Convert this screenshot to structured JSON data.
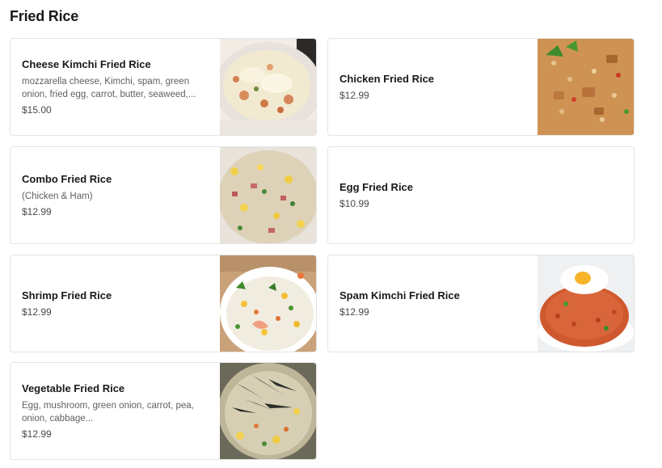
{
  "section": {
    "title": "Fried Rice"
  },
  "items": [
    {
      "name": "Cheese Kimchi Fried Rice",
      "description": "mozzarella cheese, Kimchi, spam, green onion, fried egg, carrot, butter, seaweed,...",
      "price": "$15.00",
      "image": "cheese-kimchi-fried-rice-photo"
    },
    {
      "name": "Chicken Fried Rice",
      "description": "",
      "price": "$12.99",
      "image": "chicken-fried-rice-photo"
    },
    {
      "name": "Combo Fried Rice",
      "description": "(Chicken & Ham)",
      "price": "$12.99",
      "image": "combo-fried-rice-photo"
    },
    {
      "name": "Egg Fried Rice",
      "description": "",
      "price": "$10.99",
      "image": ""
    },
    {
      "name": "Shrimp Fried Rice",
      "description": "",
      "price": "$12.99",
      "image": "shrimp-fried-rice-photo"
    },
    {
      "name": "Spam Kimchi Fried Rice",
      "description": "",
      "price": "$12.99",
      "image": "spam-kimchi-fried-rice-photo"
    },
    {
      "name": "Vegetable Fried Rice",
      "description": "Egg, mushroom, green onion, carrot, pea, onion, cabbage...",
      "price": "$12.99",
      "image": "vegetable-fried-rice-photo"
    }
  ]
}
